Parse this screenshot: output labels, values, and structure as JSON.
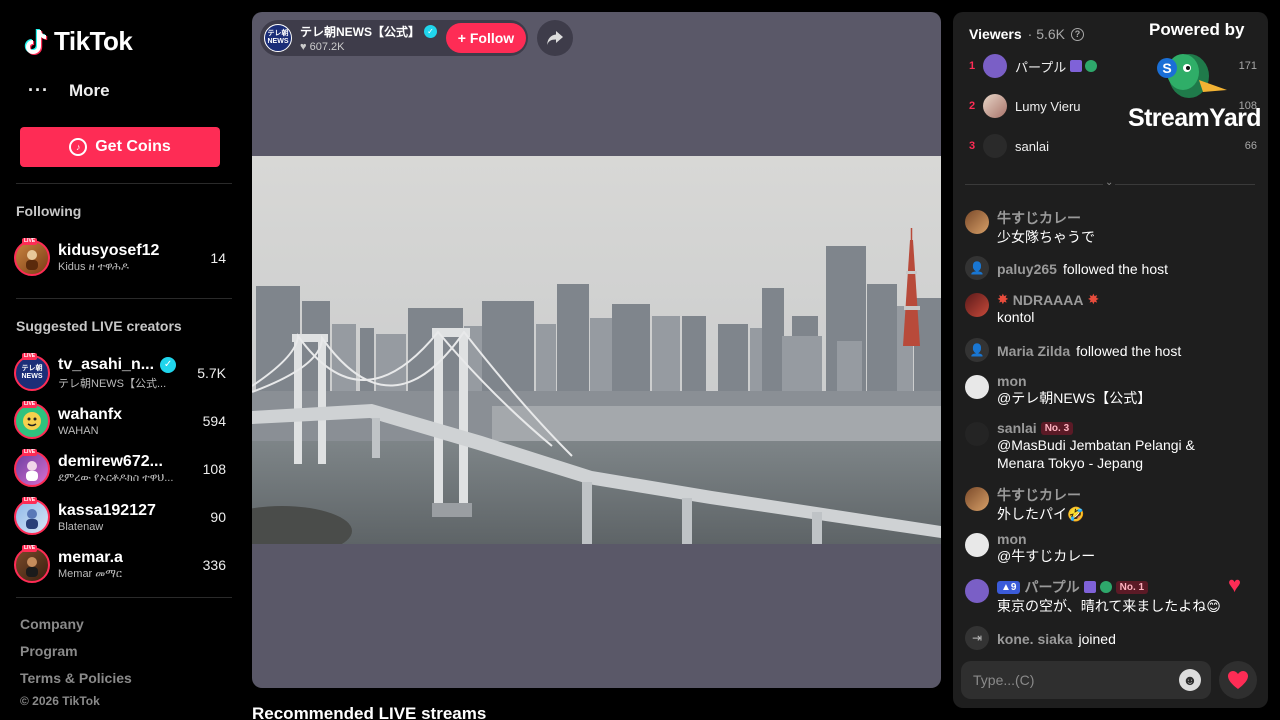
{
  "brand": {
    "name": "TikTok"
  },
  "nav": {
    "more_label": "More",
    "coins_label": "Get Coins"
  },
  "following": {
    "title": "Following",
    "items": [
      {
        "name": "kidusyosef12",
        "sub": "Kidus ዘ ተዋሕዶ",
        "count": "14"
      }
    ]
  },
  "suggested": {
    "title": "Suggested LIVE creators",
    "items": [
      {
        "name": "tv_asahi_n...",
        "sub": "テレ朝NEWS【公式...",
        "count": "5.7K",
        "verified": true,
        "av_text": "テレ朝 NEWS"
      },
      {
        "name": "wahanfx",
        "sub": "WAHAN",
        "count": "594"
      },
      {
        "name": "demirew672...",
        "sub": "ደምረው የኦርቶዶክስ ተዋህ...",
        "count": "108"
      },
      {
        "name": "kassa192127",
        "sub": "Blatenaw",
        "count": "90"
      },
      {
        "name": "memar.a",
        "sub": "Memar መማር",
        "count": "336"
      }
    ]
  },
  "footer": {
    "links": [
      "Company",
      "Program",
      "Terms & Policies"
    ],
    "copyright": "© 2026 TikTok"
  },
  "host": {
    "name": "テレ朝NEWS【公式】",
    "likes": "607.2K",
    "avatar_line1": "テレ朝",
    "avatar_line2": "NEWS",
    "follow_label": "+ Follow"
  },
  "recommended_title": "Recommended LIVE streams",
  "viewers": {
    "label": "Viewers",
    "count": "· 5.6K",
    "top": [
      {
        "rank": "1",
        "name": "パープル",
        "score": "171"
      },
      {
        "rank": "2",
        "name": "Lumy Vieru",
        "score": "108"
      },
      {
        "rank": "3",
        "name": "sanlai",
        "score": "66"
      }
    ]
  },
  "overlay": {
    "powered_by": "Powered by",
    "brand": "StreamYard"
  },
  "chat": {
    "messages": [
      {
        "user": "牛すじカレー",
        "text": "少女隊ちゃうで"
      },
      {
        "user": "paluy265",
        "text": "followed the host"
      },
      {
        "user": "NDRAAAA",
        "text": "kontol"
      },
      {
        "user": "Maria Zilda",
        "text": "followed the host"
      },
      {
        "user": "mon",
        "text": "@テレ朝NEWS【公式】"
      },
      {
        "user": "sanlai",
        "badge": "No. 3",
        "text": "@MasBudi Jembatan Pelangi & Menara Tokyo - Jepang"
      },
      {
        "user": "牛すじカレー",
        "text": "外したパイ🤣"
      },
      {
        "user": "mon",
        "text": "@牛すじカレー"
      },
      {
        "user": "パープル",
        "level": "9",
        "badge": "No. 1",
        "text": "東京の空が、晴れて来ましたよね😊"
      },
      {
        "user": "kone. siaka",
        "text": "joined"
      }
    ],
    "input_placeholder": "Type...(C)"
  },
  "colors": {
    "accent": "#fe2c55",
    "stage_bg": "#5a5868",
    "chat_bg": "#1e1e1e"
  }
}
